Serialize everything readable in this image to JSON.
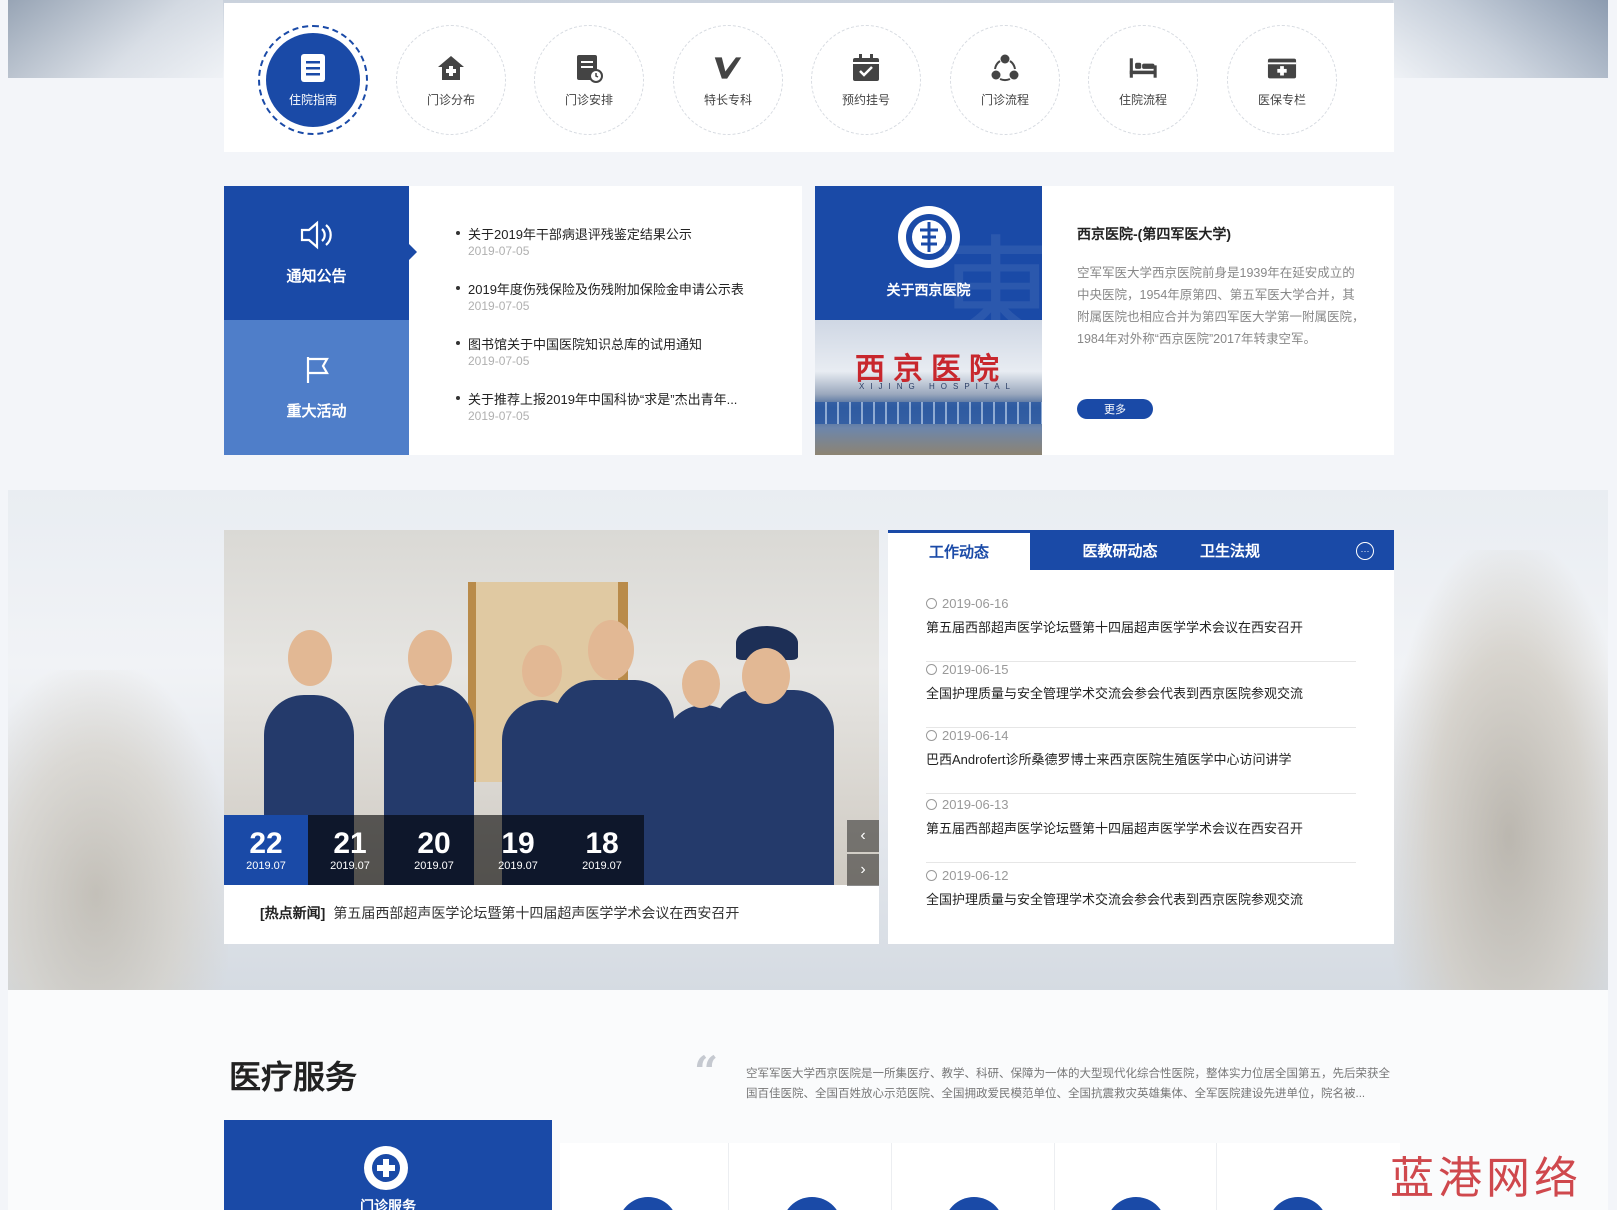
{
  "colors": {
    "primary": "#1a4aa7",
    "secondary": "#4f7ec9",
    "watermark": "#c8292f"
  },
  "services": [
    {
      "label": "住院指南",
      "icon": "document-icon",
      "active": true
    },
    {
      "label": "门诊分布",
      "icon": "home-plus-icon"
    },
    {
      "label": "门诊安排",
      "icon": "schedule-clock-icon"
    },
    {
      "label": "特长专科",
      "icon": "v-badge-icon"
    },
    {
      "label": "预约挂号",
      "icon": "calendar-check-icon"
    },
    {
      "label": "门诊流程",
      "icon": "cycle-icon"
    },
    {
      "label": "住院流程",
      "icon": "bed-icon"
    },
    {
      "label": "医保专栏",
      "icon": "insurance-card-icon"
    }
  ],
  "notice": {
    "tab_notice": "通知公告",
    "tab_events": "重大活动",
    "items": [
      {
        "title": "关于2019年干部病退评残鉴定结果公示",
        "date": "2019-07-05"
      },
      {
        "title": "2019年度伤残保险及伤残附加保险金申请公示表",
        "date": "2019-07-05"
      },
      {
        "title": "图书馆关于中国医院知识总库的试用通知",
        "date": "2019-07-05"
      },
      {
        "title": "关于推荐上报2019年中国科协“求是”杰出青年...",
        "date": "2019-07-05"
      }
    ]
  },
  "about": {
    "tab_label": "关于西京医院",
    "photo_sign": "西京医院",
    "photo_sign_en": "XIJING HOSPITAL",
    "heading": "西京医院-(第四军医大学)",
    "body": "空军军医大学西京医院前身是1939年在延安成立的中央医院，1954年原第四、第五军医大学合并，其附属医院也相应合并为第四军医大学第一附属医院，1984年对外称“西京医院”2017年转隶空军。",
    "more": "更多"
  },
  "slider": {
    "dates": [
      {
        "day": "22",
        "month": "2019.07",
        "active": true
      },
      {
        "day": "21",
        "month": "2019.07"
      },
      {
        "day": "20",
        "month": "2019.07"
      },
      {
        "day": "19",
        "month": "2019.07"
      },
      {
        "day": "18",
        "month": "2019.07"
      }
    ],
    "prev": "‹",
    "next": "›",
    "caption_tag": "[热点新闻]",
    "caption": "第五届西部超声医学论坛暨第十四届超声医学学术会议在西安召开"
  },
  "news_tabs": {
    "tabs": [
      "工作动态",
      "医教研动态",
      "卫生法规"
    ],
    "more": "···",
    "items": [
      {
        "date": "2019-06-16",
        "title": "第五届西部超声医学论坛暨第十四届超声医学学术会议在西安召开"
      },
      {
        "date": "2019-06-15",
        "title": "全国护理质量与安全管理学术交流会参会代表到西京医院参观交流"
      },
      {
        "date": "2019-06-14",
        "title": "巴西Androfert诊所桑德罗博士来西京医院生殖医学中心访问讲学"
      },
      {
        "date": "2019-06-13",
        "title": "第五届西部超声医学论坛暨第十四届超声医学学术会议在西安召开"
      },
      {
        "date": "2019-06-12",
        "title": "全国护理质量与安全管理学术交流会参会代表到西京医院参观交流"
      }
    ]
  },
  "medical": {
    "title": "医疗服务",
    "desc": "空军军医大学西京医院是一所集医疗、教学、科研、保障为一体的大型现代化综合性医院，整体实力位居全国第五，先后荣获全国百佳医院、全国百姓放心示范医院、全国拥政爱民模范单位、全国抗震救灾英雄集体、全军医院建设先进单位，院名被...",
    "outpatient": "门诊服务"
  },
  "watermark_text": "蓝港网络"
}
